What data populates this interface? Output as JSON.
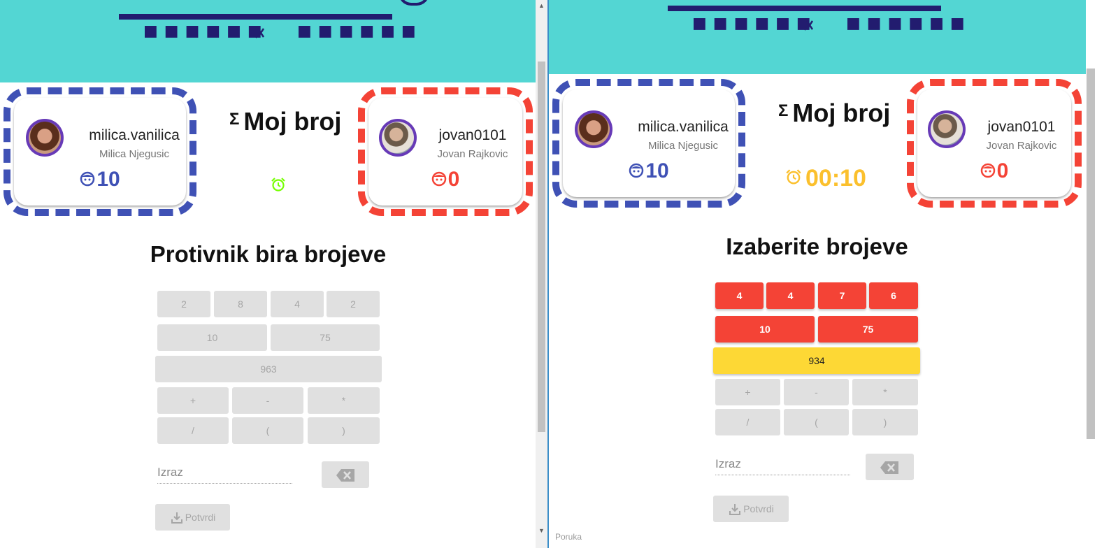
{
  "left": {
    "player1": {
      "username": "milica.vanilica",
      "fullname": "Milica Njegusic",
      "score": "10"
    },
    "player2": {
      "username": "jovan0101",
      "fullname": "Jovan Rajkovic",
      "score": "0"
    },
    "game_title": "Moj broj",
    "phase": "Protivnik bira brojeve",
    "numbers_row1": [
      "2",
      "8",
      "4",
      "2"
    ],
    "numbers_row2": [
      "10",
      "75"
    ],
    "target": "963",
    "ops_row1": [
      "+",
      "-",
      "*"
    ],
    "ops_row2": [
      "/",
      "(",
      ")"
    ],
    "expression_placeholder": "Izraz",
    "confirm_label": "Potvrdi"
  },
  "right": {
    "player1": {
      "username": "milica.vanilica",
      "fullname": "Milica Njegusic",
      "score": "10"
    },
    "player2": {
      "username": "jovan0101",
      "fullname": "Jovan Rajkovic",
      "score": "0"
    },
    "game_title": "Moj broj",
    "timer": "00:10",
    "phase": "Izaberite brojeve",
    "numbers_row1": [
      "4",
      "4",
      "7",
      "6"
    ],
    "numbers_row2": [
      "10",
      "75"
    ],
    "target": "934",
    "ops_row1": [
      "+",
      "-",
      "*"
    ],
    "ops_row2": [
      "/",
      "(",
      ")"
    ],
    "expression_placeholder": "Izraz",
    "confirm_label": "Potvrdi",
    "message_label": "Poruka"
  },
  "colors": {
    "header": "#53d6d3",
    "navy": "#221c6f",
    "player1": "#3f51b5",
    "player2": "#f44336",
    "timer": "#fbc02d",
    "alarm_green": "#76ff03",
    "target": "#fdd835"
  },
  "icons": [
    "mute-icon",
    "sigma-icon",
    "alarm-icon",
    "face-icon",
    "backspace-icon",
    "download-icon"
  ]
}
